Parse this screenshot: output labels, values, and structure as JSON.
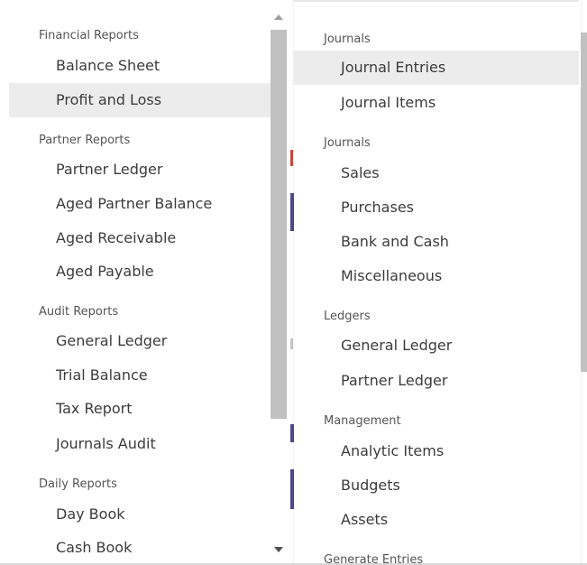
{
  "left_menu": {
    "sections": [
      {
        "header": "Financial Reports",
        "items": [
          {
            "label": "Balance Sheet",
            "active": false
          },
          {
            "label": "Profit and Loss",
            "active": true
          }
        ]
      },
      {
        "header": "Partner Reports",
        "items": [
          {
            "label": "Partner Ledger"
          },
          {
            "label": "Aged Partner Balance"
          },
          {
            "label": "Aged Receivable"
          },
          {
            "label": "Aged Payable"
          }
        ]
      },
      {
        "header": "Audit Reports",
        "items": [
          {
            "label": "General Ledger"
          },
          {
            "label": "Trial Balance"
          },
          {
            "label": "Tax Report"
          },
          {
            "label": "Journals Audit"
          }
        ]
      },
      {
        "header": "Daily Reports",
        "items": [
          {
            "label": "Day Book"
          },
          {
            "label": "Cash Book"
          }
        ]
      }
    ]
  },
  "right_menu": {
    "sections": [
      {
        "header": "Journals",
        "items": [
          {
            "label": "Journal Entries",
            "active": true
          },
          {
            "label": "Journal Items"
          }
        ]
      },
      {
        "header": "Journals",
        "items": [
          {
            "label": "Sales"
          },
          {
            "label": "Purchases"
          },
          {
            "label": "Bank and Cash"
          },
          {
            "label": "Miscellaneous"
          }
        ]
      },
      {
        "header": "Ledgers",
        "items": [
          {
            "label": "General Ledger"
          },
          {
            "label": "Partner Ledger"
          }
        ]
      },
      {
        "header": "Management",
        "items": [
          {
            "label": "Analytic Items"
          },
          {
            "label": "Budgets"
          },
          {
            "label": "Assets"
          }
        ]
      },
      {
        "header": "Generate Entries",
        "items": []
      }
    ]
  },
  "colors": {
    "active_background": "#ececec",
    "text": "#3c3c3c",
    "section_header": "#555555",
    "scrollbar_thumb": "#c1c1c1"
  }
}
